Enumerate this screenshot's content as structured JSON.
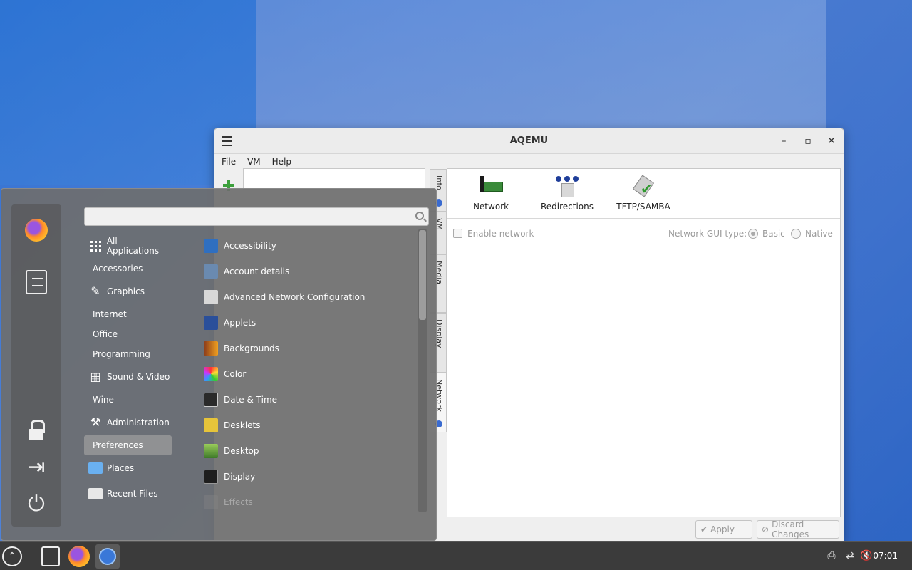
{
  "window": {
    "title": "AQEMU",
    "menu": [
      "File",
      "VM",
      "Help"
    ],
    "vtabs": [
      "Info",
      "VM",
      "Media",
      "Display",
      "Network"
    ],
    "toolbar": [
      "Network",
      "Redirections",
      "TFTP/SAMBA"
    ],
    "enable_network_label": "Enable network",
    "gui_type_label": "Network GUI type:",
    "gui_type_basic": "Basic",
    "gui_type_native": "Native",
    "apply_label": "Apply",
    "discard_label": "Discard Changes"
  },
  "appmenu": {
    "search_value": "",
    "categories": [
      {
        "label": "All Applications",
        "icon": "grid-icon"
      },
      {
        "label": "Accessories",
        "icon": ""
      },
      {
        "label": "Graphics",
        "icon": "graphics-icon"
      },
      {
        "label": "Internet",
        "icon": ""
      },
      {
        "label": "Office",
        "icon": ""
      },
      {
        "label": "Programming",
        "icon": ""
      },
      {
        "label": "Sound & Video",
        "icon": "film-icon"
      },
      {
        "label": "Wine",
        "icon": ""
      },
      {
        "label": "Administration",
        "icon": "tools-icon"
      },
      {
        "label": "Preferences",
        "icon": ""
      },
      {
        "label": "Places",
        "icon": "folder-icon"
      },
      {
        "label": "Recent Files",
        "icon": "recent-icon"
      }
    ],
    "selected_category": "Preferences",
    "apps": [
      {
        "label": "Accessibility",
        "icon": "accessibility-icon"
      },
      {
        "label": "Account details",
        "icon": "account-icon"
      },
      {
        "label": "Advanced Network Configuration",
        "icon": "network-config-icon"
      },
      {
        "label": "Applets",
        "icon": "applets-icon"
      },
      {
        "label": "Backgrounds",
        "icon": "backgrounds-icon"
      },
      {
        "label": "Color",
        "icon": "color-icon"
      },
      {
        "label": "Date & Time",
        "icon": "datetime-icon"
      },
      {
        "label": "Desklets",
        "icon": "desklets-icon"
      },
      {
        "label": "Desktop",
        "icon": "desktop-icon"
      },
      {
        "label": "Display",
        "icon": "display-icon"
      },
      {
        "label": "Effects",
        "icon": "effects-icon"
      }
    ]
  },
  "taskbar": {
    "clock": "07:01"
  }
}
